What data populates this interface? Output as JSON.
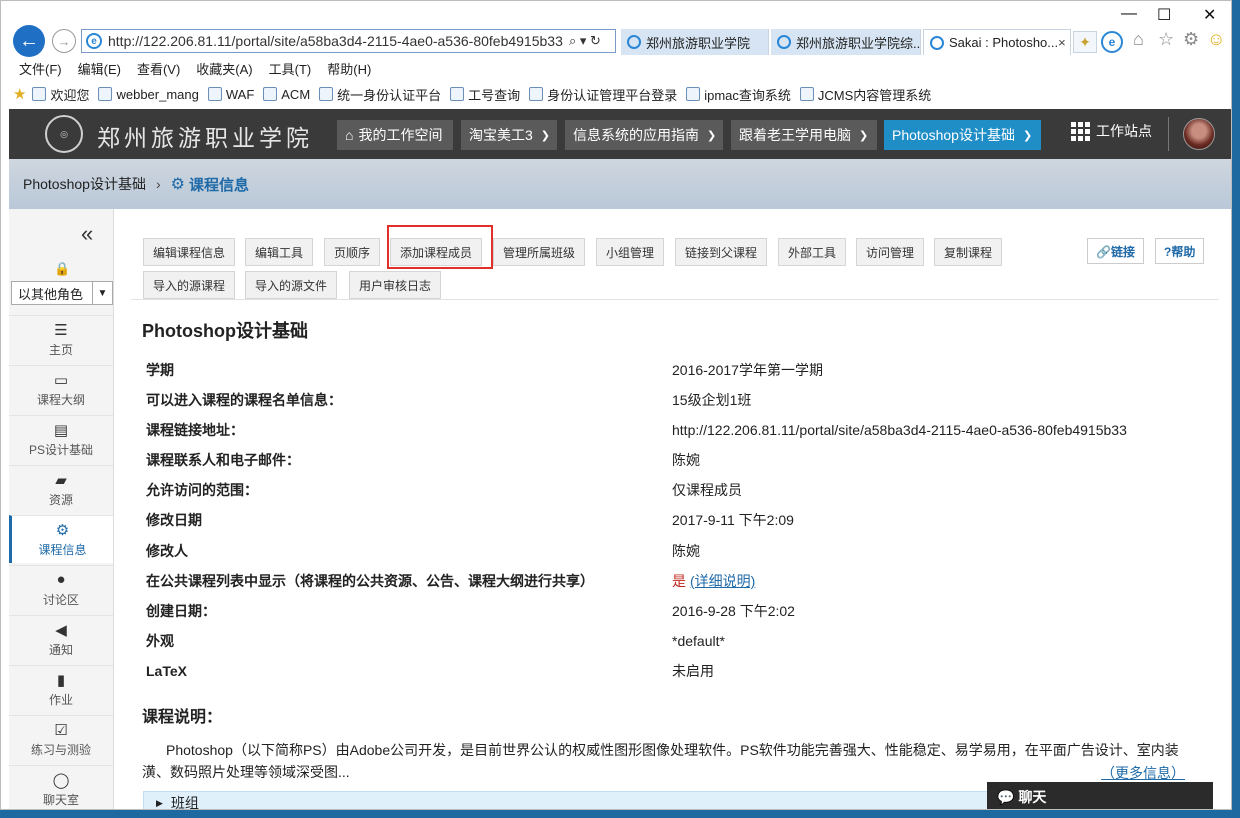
{
  "browser": {
    "url": "http://122.206.81.11/portal/site/a58ba3d4-2115-4ae0-a536-80feb4915b33/too",
    "url_controls": "⌕ ▾ ↻",
    "tabs": [
      {
        "label": "郑州旅游职业学院",
        "active": false
      },
      {
        "label": "郑州旅游职业学院综...",
        "active": false
      },
      {
        "label": "Sakai : Photosho...",
        "active": true
      }
    ],
    "tab_close": "×",
    "window_controls": {
      "minimize": "—",
      "maximize": "☐",
      "close": "✕"
    },
    "menu": [
      "文件(F)",
      "编辑(E)",
      "查看(V)",
      "收藏夹(A)",
      "工具(T)",
      "帮助(H)"
    ],
    "favorites": [
      "欢迎您",
      "webber_mang",
      "WAF",
      "ACM",
      "统一身份认证平台",
      "工号查询",
      "身份认证管理平台登录",
      "ipmac查询系统",
      "JCMS内容管理系统"
    ]
  },
  "site": {
    "name": "郑州旅游职业学院",
    "nav": [
      {
        "label": "我的工作空间",
        "icon": "home-icon"
      },
      {
        "label": "淘宝美工3"
      },
      {
        "label": "信息系统的应用指南"
      },
      {
        "label": "跟着老王学用电脑"
      },
      {
        "label": "Photoshop设计基础"
      }
    ],
    "workstation": "工作站点"
  },
  "breadcrumb": {
    "course": "Photoshop设计基础",
    "sep": "›",
    "current": "课程信息"
  },
  "sidebar": {
    "collapse": "«",
    "role_select": "以其他角色",
    "items": [
      {
        "label": "主页",
        "icon": "list-icon",
        "glyph": "☰"
      },
      {
        "label": "课程大纲",
        "icon": "map-icon",
        "glyph": "▭"
      },
      {
        "label": "PS设计基础",
        "icon": "book-icon",
        "glyph": "▤"
      },
      {
        "label": "资源",
        "icon": "folder-icon",
        "glyph": "▰"
      },
      {
        "label": "课程信息",
        "icon": "gear-icon",
        "glyph": "⚙"
      },
      {
        "label": "讨论区",
        "icon": "comment-icon",
        "glyph": "●"
      },
      {
        "label": "通知",
        "icon": "bullhorn-icon",
        "glyph": "◀"
      },
      {
        "label": "作业",
        "icon": "file-icon",
        "glyph": "▮"
      },
      {
        "label": "练习与测验",
        "icon": "check-icon",
        "glyph": "☑"
      },
      {
        "label": "聊天室",
        "icon": "chat-icon",
        "glyph": "◯"
      }
    ]
  },
  "toolbar": {
    "row1": [
      "编辑课程信息",
      "编辑工具",
      "页顺序",
      "添加课程成员",
      "管理所属班级",
      "小组管理",
      "链接到父课程",
      "外部工具",
      "访问管理",
      "复制课程"
    ],
    "row2": [
      "导入的源课程",
      "导入的源文件",
      "用户审核日志"
    ],
    "link": "🔗链接",
    "help": "?帮助"
  },
  "course": {
    "title": "Photoshop设计基础",
    "fields": [
      {
        "label": "学期",
        "value": "2016-2017学年第一学期"
      },
      {
        "label": "可以进入课程的课程名单信息：",
        "value": "15级企划1班"
      },
      {
        "label": "课程链接地址：",
        "value": "http://122.206.81.11/portal/site/a58ba3d4-2115-4ae0-a536-80feb4915b33"
      },
      {
        "label": "课程联系人和电子邮件：",
        "value": "陈婉"
      },
      {
        "label": "允许访问的范围：",
        "value": "仅课程成员"
      },
      {
        "label": "修改日期",
        "value": "2017-9-11 下午2:09"
      },
      {
        "label": "修改人",
        "value": "陈婉"
      },
      {
        "label": "在公共课程列表中显示（将课程的公共资源、公告、课程大纲进行共享）",
        "value": "是",
        "link": "(详细说明)"
      },
      {
        "label": "创建日期：",
        "value": "2016-9-28 下午2:02"
      },
      {
        "label": "外观",
        "value": "*default*"
      },
      {
        "label": "LaTeX",
        "value": "未启用"
      }
    ],
    "desc_title": "课程说明：",
    "desc_text": "Photoshop（以下简称PS）由Adobe公司开发，是目前世界公认的权威性图形图像处理软件。PS软件功能完善强大、性能稳定、易学易用，在平面广告设计、室内装潢、数码照片处理等领域深受图...",
    "more": "（更多信息）",
    "group": "班组"
  },
  "chat": {
    "label": "聊天"
  }
}
